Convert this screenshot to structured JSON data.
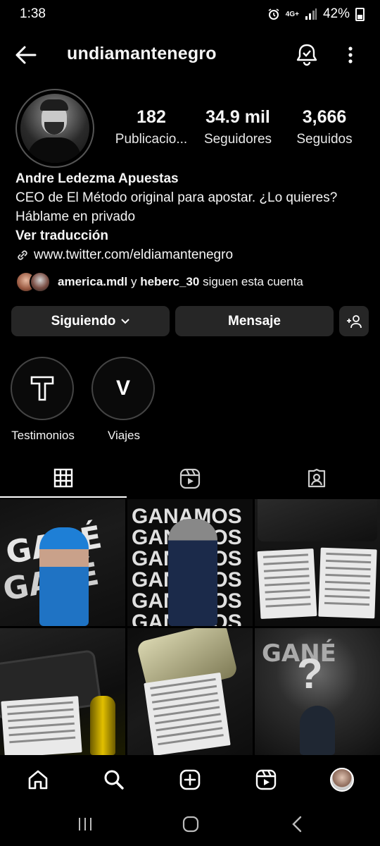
{
  "status_bar": {
    "time": "1:38",
    "network": "4G+",
    "battery": "42%"
  },
  "header": {
    "username": "undiamantenegro"
  },
  "profile": {
    "stats": [
      {
        "value": "182",
        "label": "Publicacio..."
      },
      {
        "value": "34.9 mil",
        "label": "Seguidores"
      },
      {
        "value": "3,666",
        "label": "Seguidos"
      }
    ],
    "name": "Andre Ledezma Apuestas",
    "bio_line1": "CEO de El Método original para apostar. ¿Lo quieres?",
    "bio_line2": "Háblame en privado",
    "translate": "Ver traducción",
    "link": "www.twitter.com/eldiamantenegro",
    "followed_by": {
      "user1": "america.mdl",
      "conj": "y",
      "user2": "heberc_30",
      "suffix": "siguen esta cuenta"
    }
  },
  "actions": {
    "following": "Siguiendo",
    "message": "Mensaje"
  },
  "highlights": [
    {
      "letter": "T",
      "label": "Testimonios"
    },
    {
      "letter": "V",
      "label": "Viajes"
    }
  ],
  "grid_text": {
    "post1": "GANÉ",
    "post2": "GANAMOS",
    "post6": "GANÉ"
  },
  "icons": {
    "back": "arrow-left-icon",
    "notifications": "bell-check-icon",
    "more": "kebab-icon",
    "grid_tab": "grid-icon",
    "reels_tab": "reels-icon",
    "tagged_tab": "tagged-icon",
    "home": "home-icon",
    "search": "search-icon",
    "create": "plus-square-icon",
    "reels": "reels-icon"
  }
}
